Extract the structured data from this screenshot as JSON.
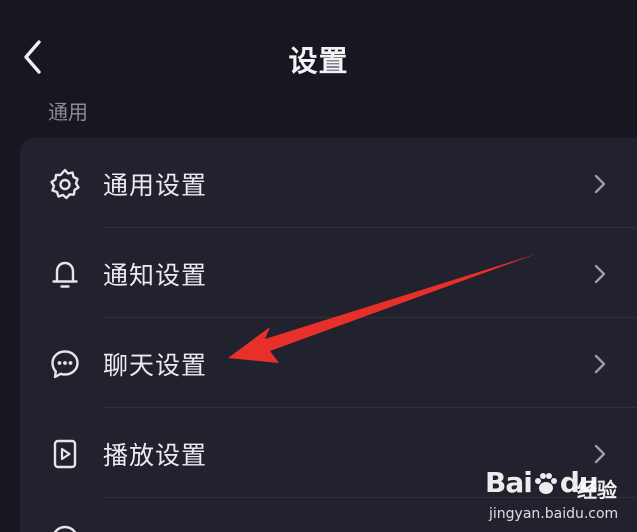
{
  "header": {
    "title": "设置",
    "back_icon": "chevron-left-icon"
  },
  "section": {
    "label": "通用"
  },
  "settings": {
    "items": [
      {
        "label": "通用设置",
        "icon": "gear-icon"
      },
      {
        "label": "通知设置",
        "icon": "bell-icon"
      },
      {
        "label": "聊天设置",
        "icon": "chat-bubble-icon"
      },
      {
        "label": "播放设置",
        "icon": "play-file-icon"
      }
    ]
  },
  "annotation": {
    "color": "#e8302a"
  },
  "watermark": {
    "brand_prefix": "Bai",
    "brand_suffix": "du",
    "brand_cn": "经验",
    "url": "jingyan.baidu.com"
  },
  "colors": {
    "background": "#161720",
    "card": "#21222d",
    "text": "#ececf0",
    "muted": "#8a8b95"
  }
}
